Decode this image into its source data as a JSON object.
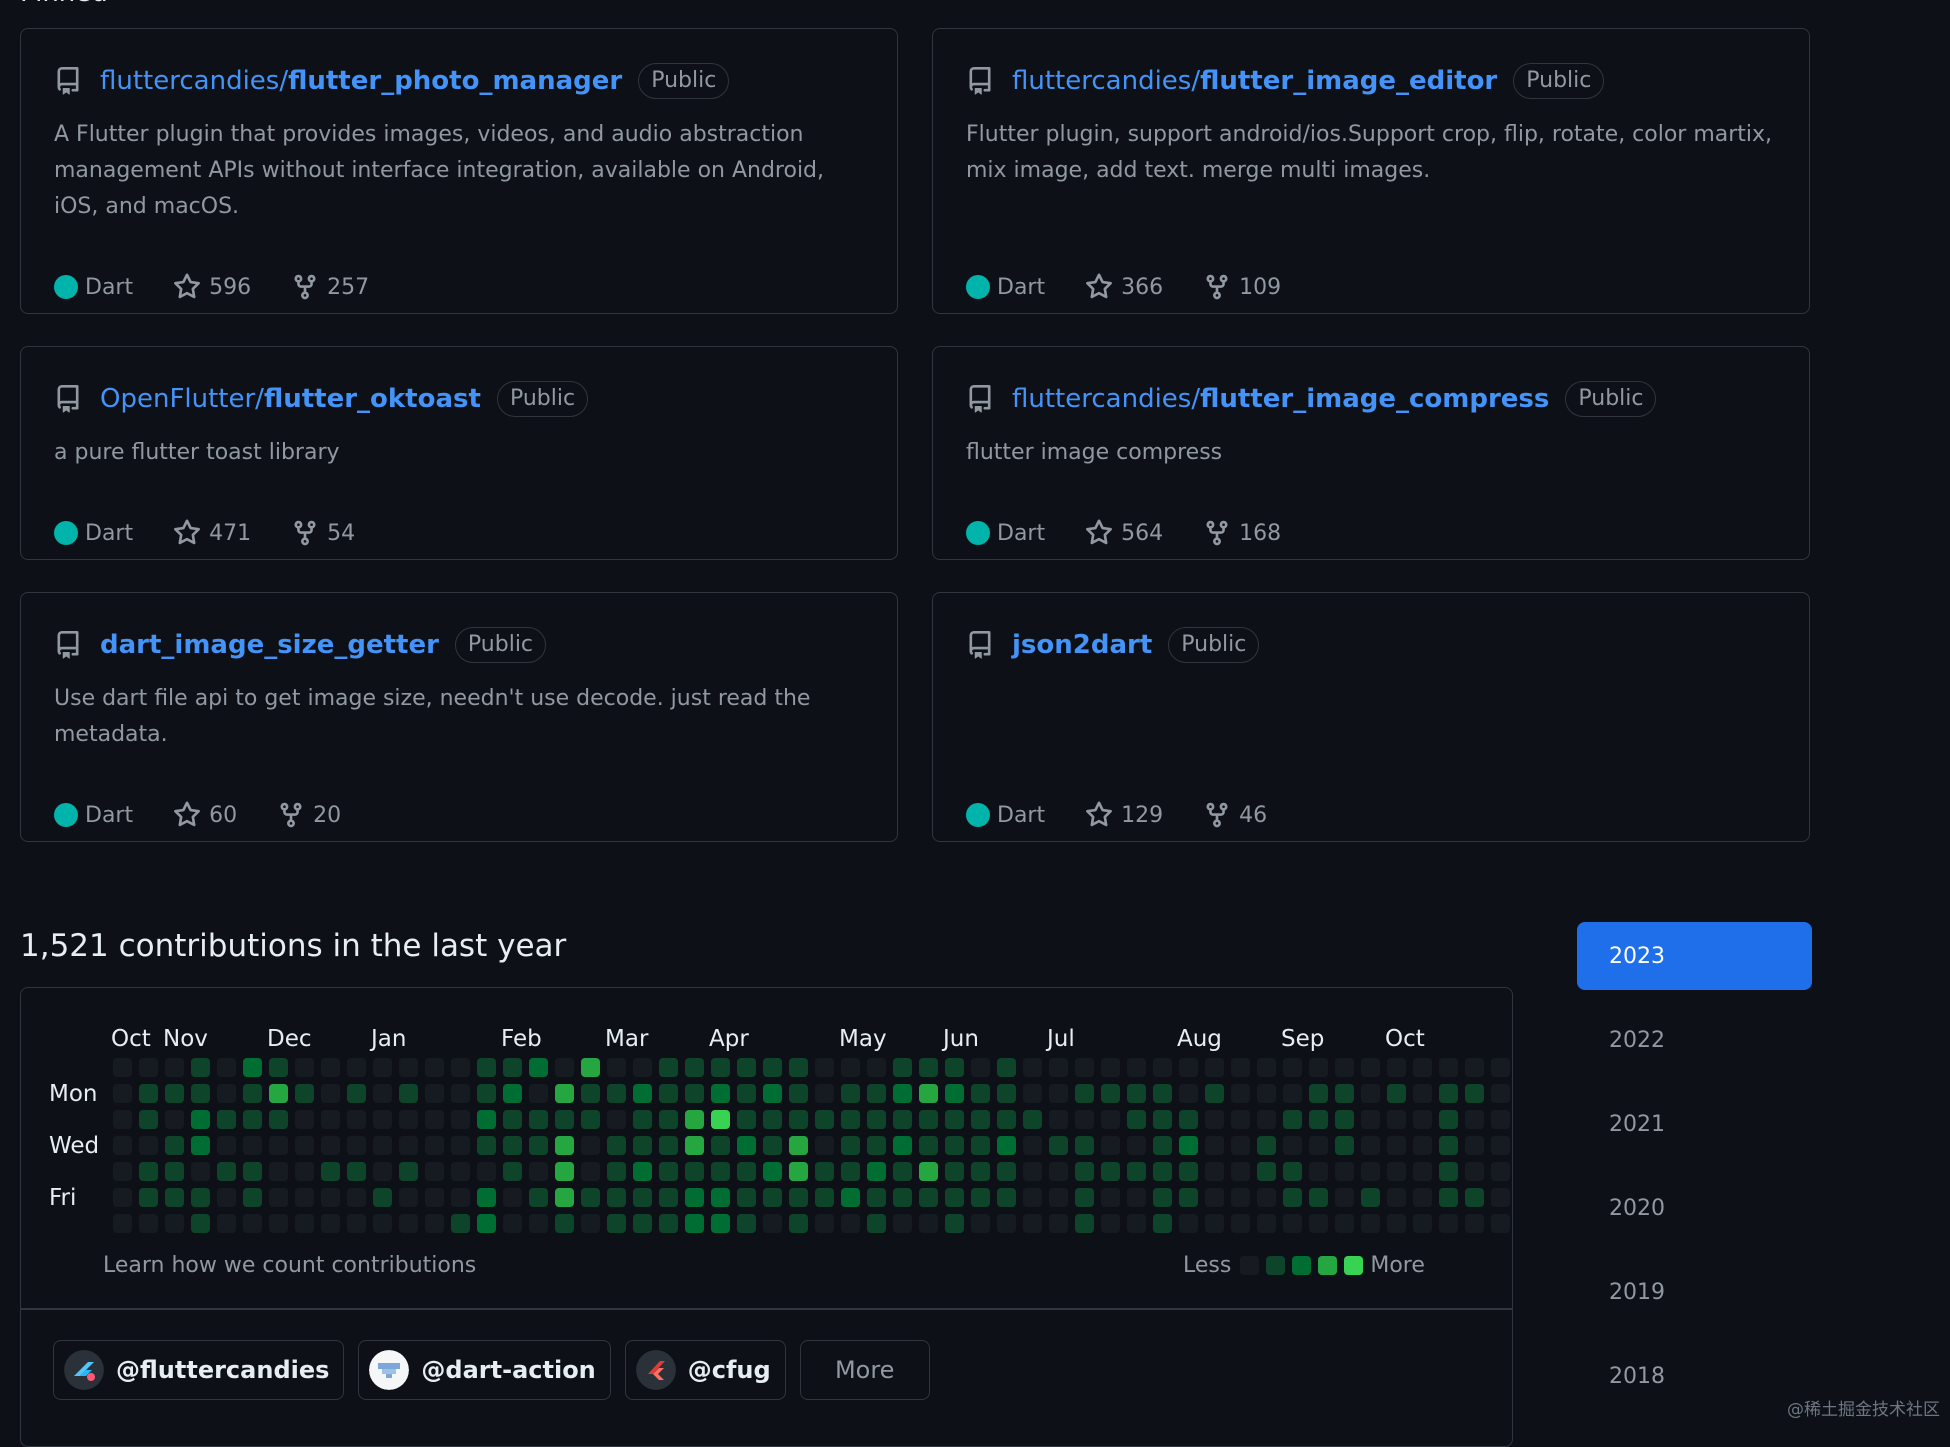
{
  "pinned": {
    "heading": "Pinned",
    "public_label": "Public",
    "repos": [
      {
        "owner": "fluttercandies/",
        "name": "flutter_photo_manager",
        "desc": "A Flutter plugin that provides images, videos, and audio abstraction management APIs without interface integration, available on Android, iOS, and macOS.",
        "language": "Dart",
        "stars": "596",
        "forks": "257"
      },
      {
        "owner": "fluttercandies/",
        "name": "flutter_image_editor",
        "desc": "Flutter plugin, support android/ios.Support crop, flip, rotate, color martix, mix image, add text. merge multi images.",
        "language": "Dart",
        "stars": "366",
        "forks": "109"
      },
      {
        "owner": "OpenFlutter/",
        "name": "flutter_oktoast",
        "desc": "a pure flutter toast library",
        "language": "Dart",
        "stars": "471",
        "forks": "54"
      },
      {
        "owner": "fluttercandies/",
        "name": "flutter_image_compress",
        "desc": "flutter image compress",
        "language": "Dart",
        "stars": "564",
        "forks": "168"
      },
      {
        "owner": "",
        "name": "dart_image_size_getter",
        "desc": "Use dart file api to get image size, needn't use decode. just read the metadata.",
        "language": "Dart",
        "stars": "60",
        "forks": "20"
      },
      {
        "owner": "",
        "name": "json2dart",
        "desc": "",
        "language": "Dart",
        "stars": "129",
        "forks": "46"
      }
    ]
  },
  "colors": {
    "dart": "#00b4ab",
    "link": "#4493f8",
    "active_year": "#1f6feb"
  },
  "contributions": {
    "title": "1,521 contributions in the last year",
    "months": [
      "Oct",
      "Nov",
      "Dec",
      "Jan",
      "Feb",
      "Mar",
      "Apr",
      "May",
      "Jun",
      "Jul",
      "Aug",
      "Sep",
      "Oct"
    ],
    "month_weeks": [
      0,
      2,
      6,
      10,
      15,
      19,
      23,
      28,
      32,
      36,
      41,
      45,
      49
    ],
    "day_labels": [
      "Mon",
      "Wed",
      "Fri"
    ],
    "levels": [
      [
        0,
        0,
        0,
        0,
        0,
        0,
        0
      ],
      [
        0,
        1,
        1,
        0,
        1,
        1,
        0
      ],
      [
        0,
        1,
        0,
        1,
        1,
        1,
        0
      ],
      [
        1,
        1,
        2,
        2,
        0,
        1,
        1
      ],
      [
        0,
        0,
        1,
        0,
        1,
        0,
        0
      ],
      [
        2,
        1,
        1,
        0,
        1,
        1,
        0
      ],
      [
        1,
        3,
        1,
        0,
        0,
        0,
        0
      ],
      [
        0,
        1,
        0,
        0,
        0,
        0,
        0
      ],
      [
        0,
        0,
        0,
        0,
        1,
        0,
        0
      ],
      [
        0,
        1,
        0,
        0,
        1,
        0,
        0
      ],
      [
        0,
        0,
        0,
        0,
        0,
        1,
        0
      ],
      [
        0,
        1,
        0,
        0,
        1,
        0,
        0
      ],
      [
        0,
        0,
        0,
        0,
        0,
        0,
        0
      ],
      [
        0,
        0,
        0,
        0,
        0,
        0,
        1
      ],
      [
        1,
        1,
        2,
        1,
        0,
        2,
        2
      ],
      [
        1,
        2,
        1,
        1,
        1,
        0,
        0
      ],
      [
        2,
        0,
        1,
        1,
        0,
        1,
        0
      ],
      [
        0,
        3,
        1,
        3,
        3,
        3,
        1
      ],
      [
        3,
        1,
        1,
        0,
        0,
        1,
        0
      ],
      [
        0,
        1,
        0,
        1,
        1,
        1,
        1
      ],
      [
        0,
        2,
        1,
        1,
        2,
        1,
        1
      ],
      [
        1,
        1,
        1,
        1,
        1,
        1,
        1
      ],
      [
        1,
        1,
        3,
        3,
        1,
        2,
        2
      ],
      [
        1,
        2,
        4,
        1,
        1,
        2,
        2
      ],
      [
        1,
        1,
        1,
        2,
        1,
        1,
        1
      ],
      [
        1,
        2,
        1,
        1,
        2,
        1,
        0
      ],
      [
        1,
        1,
        1,
        3,
        3,
        1,
        1
      ],
      [
        0,
        0,
        1,
        0,
        1,
        1,
        0
      ],
      [
        0,
        1,
        1,
        1,
        1,
        2,
        0
      ],
      [
        0,
        1,
        1,
        1,
        2,
        1,
        1
      ],
      [
        1,
        2,
        1,
        2,
        1,
        1,
        0
      ],
      [
        1,
        3,
        1,
        1,
        3,
        1,
        0
      ],
      [
        1,
        2,
        1,
        1,
        1,
        1,
        1
      ],
      [
        0,
        1,
        1,
        1,
        1,
        1,
        0
      ],
      [
        1,
        1,
        1,
        2,
        1,
        1,
        0
      ],
      [
        0,
        0,
        1,
        0,
        0,
        0,
        0
      ],
      [
        0,
        0,
        0,
        1,
        0,
        0,
        0
      ],
      [
        0,
        1,
        0,
        1,
        1,
        1,
        1
      ],
      [
        0,
        1,
        0,
        0,
        1,
        0,
        0
      ],
      [
        0,
        1,
        1,
        0,
        1,
        0,
        0
      ],
      [
        0,
        1,
        1,
        1,
        1,
        1,
        1
      ],
      [
        0,
        0,
        1,
        2,
        1,
        1,
        0
      ],
      [
        0,
        1,
        0,
        0,
        0,
        0,
        0
      ],
      [
        0,
        0,
        0,
        0,
        0,
        0,
        0
      ],
      [
        0,
        0,
        0,
        1,
        1,
        0,
        0
      ],
      [
        0,
        0,
        1,
        0,
        1,
        1,
        0
      ],
      [
        0,
        1,
        1,
        0,
        0,
        1,
        0
      ],
      [
        0,
        1,
        1,
        1,
        0,
        0,
        0
      ],
      [
        0,
        0,
        0,
        0,
        0,
        1,
        0
      ],
      [
        0,
        1,
        0,
        0,
        0,
        0,
        0
      ],
      [
        0,
        0,
        0,
        0,
        0,
        0,
        0
      ],
      [
        0,
        1,
        1,
        1,
        1,
        1,
        0
      ],
      [
        0,
        1,
        0,
        0,
        0,
        1,
        0
      ],
      [
        0,
        0,
        0,
        0,
        0,
        0,
        0
      ]
    ],
    "learn_link": "Learn how we count contributions",
    "legend_less": "Less",
    "legend_more": "More",
    "level_colors": [
      "#161b22",
      "#0e4429",
      "#006d32",
      "#26a641",
      "#39d353"
    ]
  },
  "orgs": [
    {
      "name": "@fluttercandies",
      "icon": "fluttercandies-avatar"
    },
    {
      "name": "@dart-action",
      "icon": "dart-action-avatar"
    },
    {
      "name": "@cfug",
      "icon": "cfug-avatar"
    }
  ],
  "orgs_more": "More",
  "years": [
    "2023",
    "2022",
    "2021",
    "2020",
    "2019",
    "2018"
  ],
  "active_year": "2023",
  "watermark": "@稀土掘金技术社区"
}
